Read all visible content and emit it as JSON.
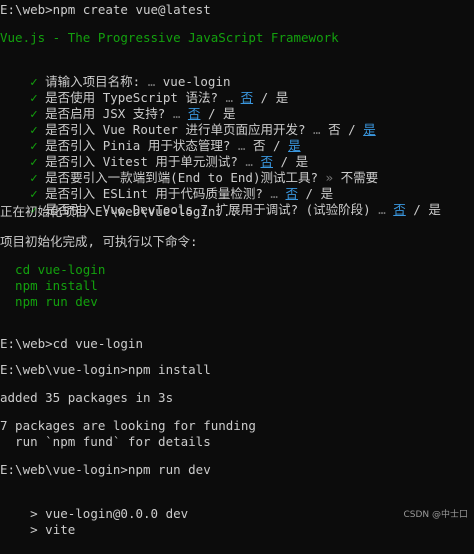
{
  "lines": {
    "l1": "E:\\web>npm create vue@latest",
    "l2": "Vue.js - The Progressive JavaScript Framework",
    "q1": {
      "check": "✓",
      "q": "请输入项目名称:",
      "dots": " … ",
      "ans": "vue-login"
    },
    "q2": {
      "check": "✓",
      "q": "是否使用 TypeScript 语法?",
      "dots": " … ",
      "no": "否",
      "sep": " / ",
      "yes": "是"
    },
    "q3": {
      "check": "✓",
      "q": "是否启用 JSX 支持?",
      "dots": " … ",
      "no": "否",
      "sep": " / ",
      "yes": "是"
    },
    "q4": {
      "check": "✓",
      "q": "是否引入 Vue Router 进行单页面应用开发?",
      "dots": " … ",
      "no": "否",
      "sep": " / ",
      "yes": "是"
    },
    "q5": {
      "check": "✓",
      "q": "是否引入 Pinia 用于状态管理?",
      "dots": " … ",
      "no": "否",
      "sep": " / ",
      "yes": "是"
    },
    "q6": {
      "check": "✓",
      "q": "是否引入 Vitest 用于单元测试?",
      "dots": " … ",
      "no": "否",
      "sep": " / ",
      "yes": "是"
    },
    "q7": {
      "check": "✓",
      "q": "是否要引入一款端到端(End to End)测试工具?",
      "arrow": " » ",
      "ans": "不需要"
    },
    "q8": {
      "check": "✓",
      "q": "是否引入 ESLint 用于代码质量检测?",
      "dots": " … ",
      "no": "否",
      "sep": " / ",
      "yes": "是"
    },
    "q9": {
      "check": "✓",
      "q": "是否引入 Vue DevTools 7 扩展用于调试? (试验阶段)",
      "dots": " … ",
      "no": "否",
      "sep": " / ",
      "yes": "是"
    },
    "init": "正在初始化项目 E:\\web\\vue-login...",
    "done": "项目初始化完成, 可执行以下命令:",
    "cmd1": "  cd vue-login",
    "cmd2": "  npm install",
    "cmd3": "  npm run dev",
    "p1": "E:\\web>cd vue-login",
    "p2": "E:\\web\\vue-login>npm install",
    "added": "added 35 packages in 3s",
    "fund1": "7 packages are looking for funding",
    "fund2": "  run `npm fund` for details",
    "p3": "E:\\web\\vue-login>npm run dev",
    "dev1_mark": ">",
    "dev1": " vue-login@0.0.0 dev",
    "dev2_mark": ">",
    "dev2": " vite"
  },
  "watermark": "CSDN @中士口"
}
